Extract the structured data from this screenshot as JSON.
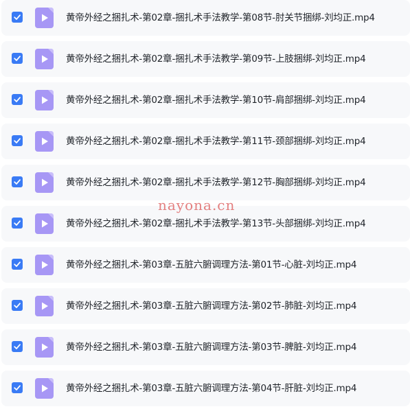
{
  "accent_color": "#3a7bf5",
  "icon_color": "#a797f5",
  "files": [
    {
      "name": "黄帝外经之捆扎术-第02章-捆扎术手法教学-第08节-肘关节捆绑-刘均正.mp4",
      "checked": true,
      "icon": "video-file-icon"
    },
    {
      "name": "黄帝外经之捆扎术-第02章-捆扎术手法教学-第09节-上肢捆绑-刘均正.mp4",
      "checked": true,
      "icon": "video-file-icon"
    },
    {
      "name": "黄帝外经之捆扎术-第02章-捆扎术手法教学-第10节-肩部捆绑-刘均正.mp4",
      "checked": true,
      "icon": "video-file-icon"
    },
    {
      "name": "黄帝外经之捆扎术-第02章-捆扎术手法教学-第11节-颈部捆绑-刘均正.mp4",
      "checked": true,
      "icon": "video-file-icon"
    },
    {
      "name": "黄帝外经之捆扎术-第02章-捆扎术手法教学-第12节-胸部捆绑-刘均正.mp4",
      "checked": true,
      "icon": "video-file-icon"
    },
    {
      "name": "黄帝外经之捆扎术-第02章-捆扎术手法教学-第13节-头部捆绑-刘均正.mp4",
      "checked": true,
      "icon": "video-file-icon"
    },
    {
      "name": "黄帝外经之捆扎术-第03章-五脏六腑调理方法-第01节-心脏-刘均正.mp4",
      "checked": true,
      "icon": "video-file-icon"
    },
    {
      "name": "黄帝外经之捆扎术-第03章-五脏六腑调理方法-第02节-肺脏-刘均正.mp4",
      "checked": true,
      "icon": "video-file-icon"
    },
    {
      "name": "黄帝外经之捆扎术-第03章-五脏六腑调理方法-第03节-脾脏-刘均正.mp4",
      "checked": true,
      "icon": "video-file-icon"
    },
    {
      "name": "黄帝外经之捆扎术-第03章-五脏六腑调理方法-第04节-肝脏-刘均正.mp4",
      "checked": true,
      "icon": "video-file-icon"
    }
  ],
  "watermark": "nayona.cn"
}
